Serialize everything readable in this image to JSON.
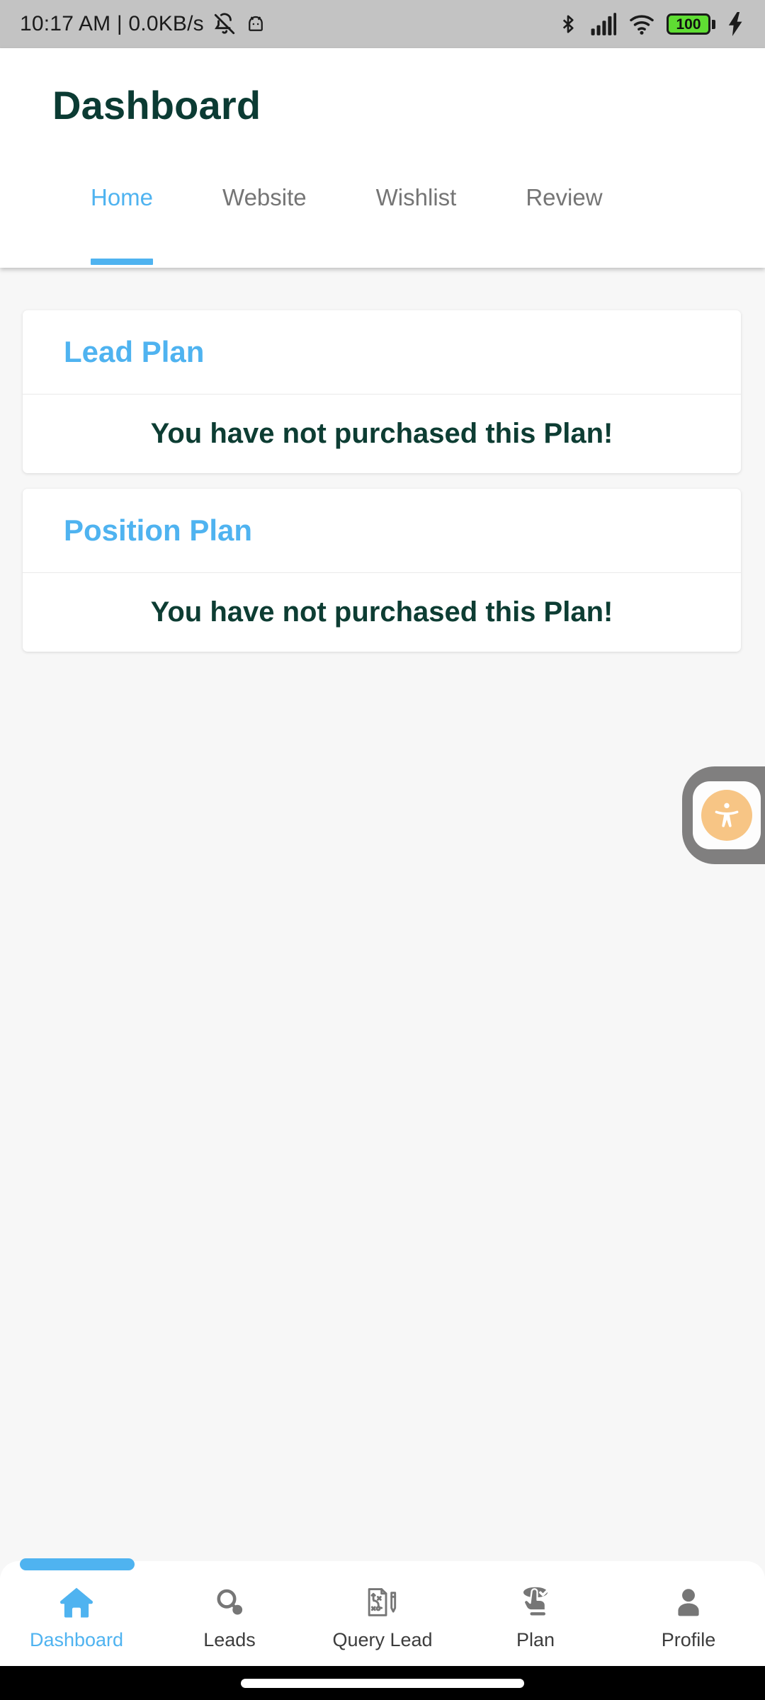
{
  "status_bar": {
    "time_and_net": "10:17 AM | 0.0KB/s",
    "icons": [
      "bell-muted-icon",
      "android-head-icon",
      "bluetooth-icon",
      "cellular-signal-icon",
      "wifi-icon",
      "battery-icon",
      "charging-bolt-icon"
    ],
    "battery_level": "100",
    "battery_color": "#5fdd33",
    "background": "#c3c3c3"
  },
  "app_bar": {
    "title": "Dashboard",
    "title_color": "#0b3b33",
    "tabs": [
      {
        "label": "Home",
        "active": true
      },
      {
        "label": "Website",
        "active": false
      },
      {
        "label": "Wishlist",
        "active": false
      },
      {
        "label": "Review",
        "active": false
      }
    ],
    "active_tab_color": "#4fb3f0",
    "inactive_tab_color": "#757575"
  },
  "main": {
    "background": "#f7f7f7",
    "cards": [
      {
        "title": "Lead Plan",
        "message": "You have not purchased this Plan!"
      },
      {
        "title": "Position Plan",
        "message": "You have not purchased this Plan!"
      }
    ],
    "card_title_color": "#4fb3f0",
    "card_message_color": "#0d3d33"
  },
  "accessibility_fab": {
    "name": "accessibility-floating-button",
    "pill_color": "#807f7f",
    "circle_color": "#f7c585"
  },
  "bottom_nav": {
    "items": [
      {
        "label": "Dashboard",
        "icon": "home-icon",
        "active": true
      },
      {
        "label": "Leads",
        "icon": "search-icon",
        "active": false
      },
      {
        "label": "Query Lead",
        "icon": "strategy-document-pencil-icon",
        "active": false
      },
      {
        "label": "Plan",
        "icon": "hand-tap-check-icon",
        "active": false
      },
      {
        "label": "Profile",
        "icon": "person-icon",
        "active": false
      }
    ],
    "active_color": "#4fb3f0",
    "inactive_color": "#767676"
  }
}
